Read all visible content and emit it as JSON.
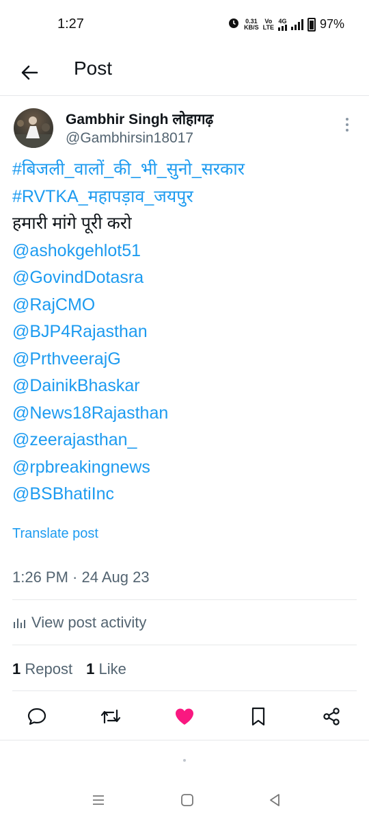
{
  "status": {
    "time": "1:27",
    "speed_value": "0.31",
    "speed_unit": "KB/S",
    "volte_top": "Vo",
    "volte_bottom": "LTE",
    "network": "4G",
    "battery": "97%"
  },
  "header": {
    "title": "Post"
  },
  "post": {
    "author_name": "Gambhir Singh लोहागढ़",
    "author_handle": "@Gambhirsin18017",
    "lines": [
      {
        "text": "#बिजली_वालों_की_भी_सुनो_सरकार",
        "kind": "link"
      },
      {
        "text": "#RVTKA_महापड़ाव_जयपुर",
        "kind": "link"
      },
      {
        "text": "हमारी मांगे पूरी करो",
        "kind": "plain"
      },
      {
        "text": "@ashokgehlot51",
        "kind": "link"
      },
      {
        "text": "@GovindDotasra",
        "kind": "link"
      },
      {
        "text": "@RajCMO",
        "kind": "link"
      },
      {
        "text": "@BJP4Rajasthan",
        "kind": "link"
      },
      {
        "text": "@PrthveerajG",
        "kind": "link"
      },
      {
        "text": "@DainikBhaskar",
        "kind": "link"
      },
      {
        "text": "@News18Rajasthan",
        "kind": "link"
      },
      {
        "text": "@zeerajasthan_",
        "kind": "link"
      },
      {
        "text": "@rpbreakingnews",
        "kind": "link"
      },
      {
        "text": "@BSBhatiInc",
        "kind": "link"
      }
    ],
    "translate_label": "Translate post",
    "timestamp": "1:26 PM · 24 Aug 23",
    "activity_label": "View post activity",
    "repost_count": "1",
    "repost_label": "Repost",
    "like_count": "1",
    "like_label": "Like"
  },
  "actions": {
    "icons": [
      "reply-icon",
      "repost-icon",
      "like-icon",
      "bookmark-icon",
      "share-icon"
    ],
    "like_color": "#f91880",
    "icon_color": "#536471"
  },
  "colors": {
    "link": "#1d9bf0",
    "text": "#0f1419",
    "secondary": "#536471"
  }
}
